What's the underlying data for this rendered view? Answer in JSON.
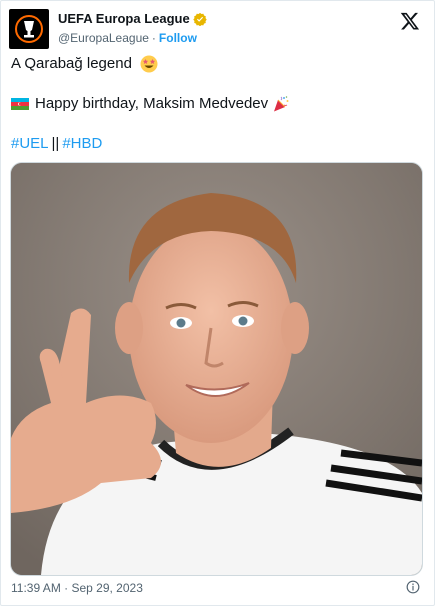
{
  "author": {
    "name": "UEFA Europa League",
    "handle": "@EuropaLeague",
    "separator": "·",
    "follow_label": "Follow",
    "verified_color": "#e8b600"
  },
  "tweet": {
    "line1_text": "A Qarabağ legend",
    "line1_emoji": "star-struck-emoji",
    "line2_text": "Happy birthday, Maksim Medvedev",
    "line2_emoji": "party-popper-emoji",
    "hashtags": [
      "#UEL",
      "#HBD"
    ],
    "hashtag_separator": "||"
  },
  "media": {
    "kind": "photo",
    "subject": "player-portrait"
  },
  "footer": {
    "timestamp": "11:39 AM · Sep 29, 2023"
  },
  "colors": {
    "link": "#1d9bf0",
    "muted": "#536471",
    "text": "#0f1419"
  }
}
